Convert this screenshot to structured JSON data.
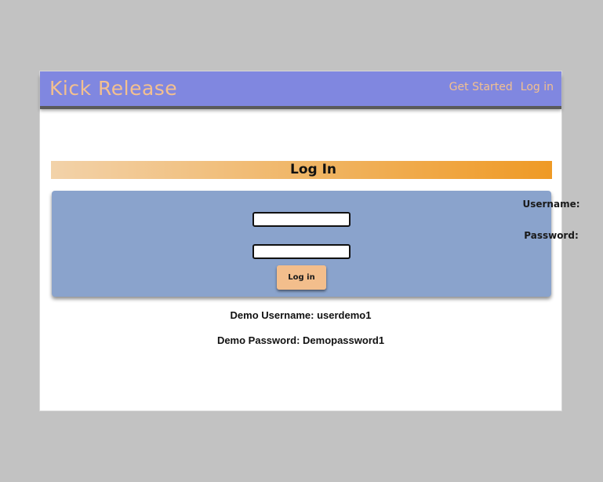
{
  "header": {
    "brand": "Kick Release",
    "links": [
      {
        "label": "Get Started"
      },
      {
        "label": "Log in"
      }
    ]
  },
  "login": {
    "title": "Log In",
    "username_label": "Username:",
    "username_value": "",
    "password_label": "Password:",
    "password_value": "",
    "button_label": "Log in"
  },
  "demo": {
    "username_text": "Demo Username: userdemo1",
    "password_text": "Demo Password: Demopassword1"
  },
  "colors": {
    "page_background": "#c2c2c2",
    "navbar": "#8087e0",
    "brand_text": "#f3c08f",
    "title_gradient_start": "#f2d2a9",
    "title_gradient_end": "#ef9a25",
    "panel": "#8aa3cc",
    "button": "#f3be8c"
  }
}
